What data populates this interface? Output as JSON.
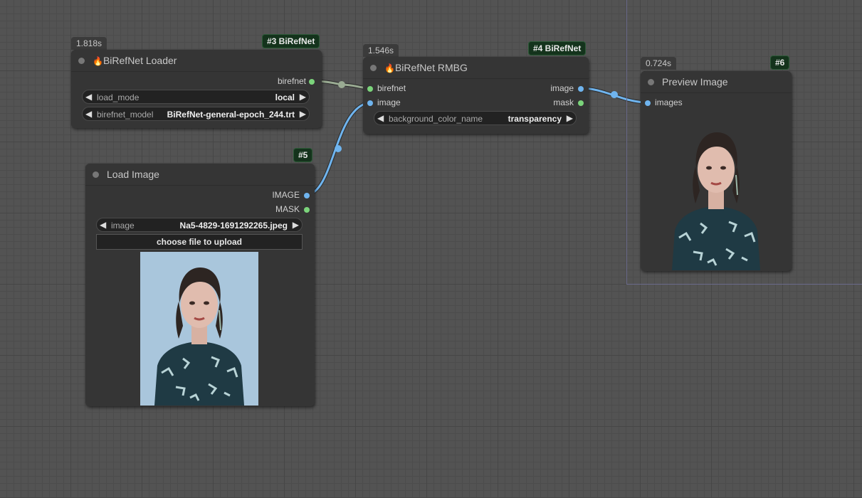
{
  "nodes": {
    "loader": {
      "time": "1.818s",
      "badge": "#3 BiRefNet",
      "icon": "flame-icon",
      "title": "BiRefNet Loader",
      "output": "birefnet",
      "widgets": [
        {
          "name": "load_mode",
          "value": "local"
        },
        {
          "name": "birefnet_model",
          "value": "BiRefNet-general-epoch_244.trt"
        }
      ]
    },
    "rmbg": {
      "time": "1.546s",
      "badge": "#4 BiRefNet",
      "icon": "flame-icon",
      "title": "BiRefNet RMBG",
      "inputs": [
        "birefnet",
        "image"
      ],
      "outputs": [
        "image",
        "mask"
      ],
      "widgets": [
        {
          "name": "background_color_name",
          "value": "transparency"
        }
      ]
    },
    "load_image": {
      "badge": "#5",
      "title": "Load Image",
      "outputs": [
        "IMAGE",
        "MASK"
      ],
      "widgets": [
        {
          "name": "image",
          "value": "Na5-4829-1691292265.jpeg"
        }
      ],
      "upload_button": "choose file to upload"
    },
    "preview": {
      "time": "0.724s",
      "badge": "#6",
      "title": "Preview Image",
      "inputs": [
        "images"
      ]
    }
  },
  "colors": {
    "canvas": "#535353",
    "node_bg": "#353535",
    "link_image": "#6fb4ee",
    "link_birefnet": "#9aab93",
    "port_green": "#7bd47b",
    "port_blue": "#6fb4ee",
    "badge_bg": "#14331c",
    "photo_bg_blue": "#a9c6dc"
  }
}
